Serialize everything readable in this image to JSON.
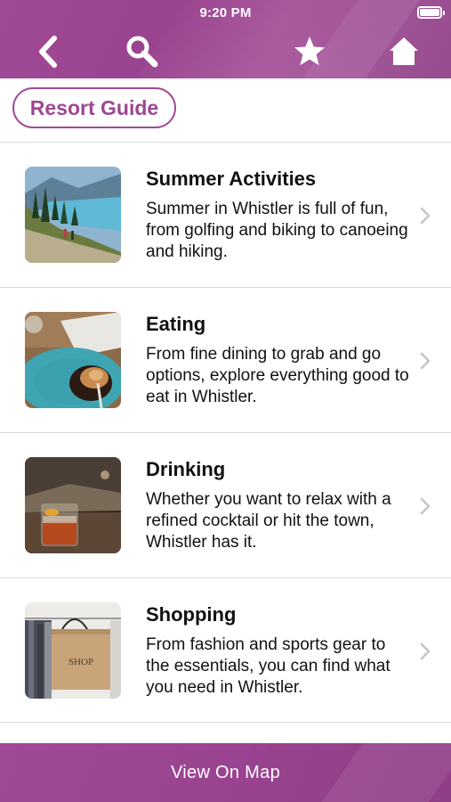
{
  "status_bar": {
    "time": "9:20 PM"
  },
  "header": {
    "icons": [
      "back-icon",
      "search-icon",
      "star-icon",
      "home-icon"
    ],
    "color": "#a04a97"
  },
  "guide_button": {
    "label": "Resort Guide"
  },
  "items": [
    {
      "title": "Summer Activities",
      "description": "Summer in Whistler is full of fun, from golfing and biking to canoeing and hiking.",
      "image": "mountain-hikers-lake"
    },
    {
      "title": "Eating",
      "description": "From fine  dining to grab and go options, explore everything good to eat in Whistler.",
      "image": "plated-dish"
    },
    {
      "title": "Drinking",
      "description": "Whether you want to relax with a refined cocktail or hit the town, Whistler has it.",
      "image": "cocktail-glass"
    },
    {
      "title": "Shopping",
      "description": "From fashion and sports gear to the essentials, you can find what you need in Whistler.",
      "image": "shop-bag"
    }
  ],
  "footer": {
    "label": "View On Map"
  },
  "colors": {
    "accent": "#a04a97",
    "divider": "#dcdcdc",
    "chevron": "#c4c4c4"
  }
}
